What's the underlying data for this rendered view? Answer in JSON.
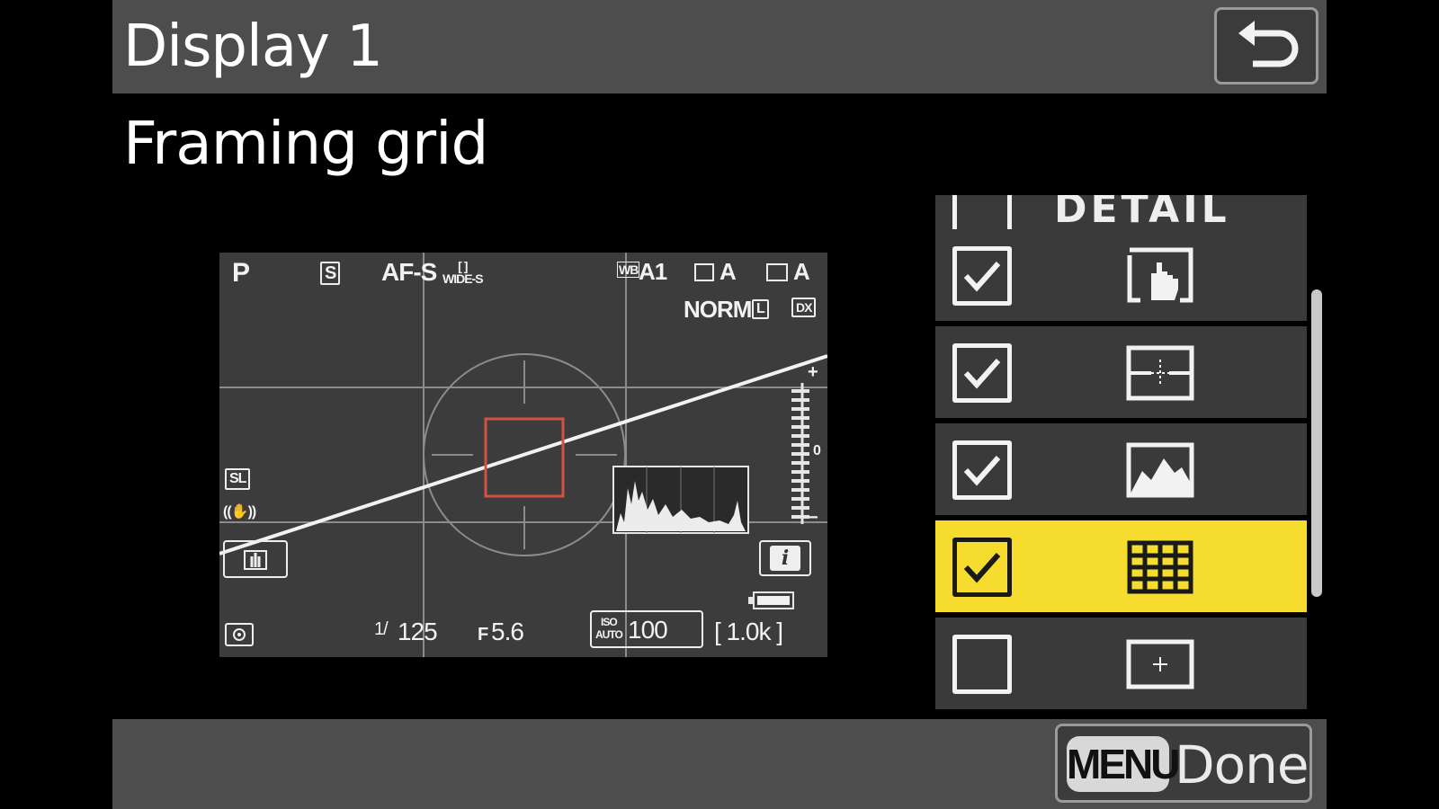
{
  "header": {
    "title": "Display 1",
    "back_icon": "return-arrow-icon"
  },
  "subtitle": "Framing grid",
  "preview": {
    "mode": "P",
    "release_mode": "S",
    "focus_mode": "AF-S",
    "af_area_top": "[ ]",
    "af_area_bottom": "WIDE-S",
    "wb_badge": "WB",
    "wb_value": "A1",
    "picture_ctrl": "A",
    "active_d_lighting": "A",
    "quality": "NORM",
    "size": "L",
    "crop": "DX",
    "release_timing": "SL",
    "vr": "((✋))",
    "shutter_prefix": "1/",
    "shutter_value": "125",
    "aperture_prefix": "F",
    "aperture_value": "5.6",
    "iso_top": "ISO",
    "iso_bottom": "AUTO",
    "iso_value": "100",
    "shots": "[ 1.0k ]",
    "info_button": "i",
    "exposure_plus": "+",
    "exposure_zero": "0",
    "exposure_minus": "−"
  },
  "list": {
    "items": [
      {
        "checked": false,
        "icon": "detail-label-partial",
        "label": "DETAIL"
      },
      {
        "checked": true,
        "icon": "touch-shutter-icon"
      },
      {
        "checked": true,
        "icon": "virtual-horizon-icon"
      },
      {
        "checked": true,
        "icon": "histogram-icon"
      },
      {
        "checked": true,
        "icon": "framing-grid-icon",
        "selected": true
      },
      {
        "checked": false,
        "icon": "center-mark-icon"
      }
    ]
  },
  "footer": {
    "menu_badge": "MENU",
    "done_label": "Done"
  },
  "colors": {
    "selected_row": "#f6dc2f",
    "af_frame": "#d0533f",
    "panel": "#3a3a3a",
    "bar": "#4d4d4d"
  }
}
